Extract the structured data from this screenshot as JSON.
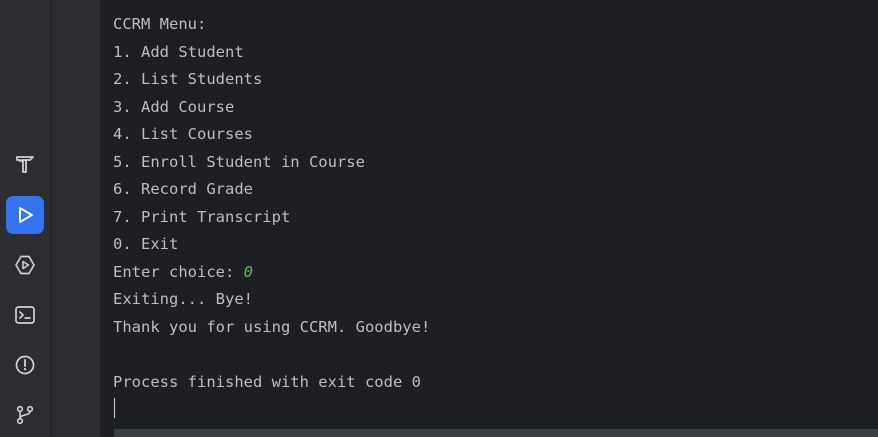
{
  "toolbar": {
    "items": [
      {
        "icon": "build-hammer-icon",
        "active": false
      },
      {
        "icon": "run-icon",
        "active": true
      },
      {
        "icon": "services-icon",
        "active": false
      },
      {
        "icon": "terminal-icon",
        "active": false
      },
      {
        "icon": "problems-icon",
        "active": false
      },
      {
        "icon": "git-branch-icon",
        "active": false
      }
    ],
    "accent_color": "#3574f0"
  },
  "console": {
    "menu_title": "CCRM Menu:",
    "options": [
      "1. Add Student",
      "2. List Students",
      "3. Add Course",
      "4. List Courses",
      "5. Enroll Student in Course",
      "6. Record Grade",
      "7. Print Transcript",
      "0. Exit"
    ],
    "prompt": "Enter choice: ",
    "user_input": "0",
    "exit_message": "Exiting... Bye!",
    "goodbye_message": "Thank you for using CCRM. Goodbye!",
    "process_status": "Process finished with exit code 0",
    "text_color": "#bcbec4",
    "input_color": "#5fb865"
  }
}
